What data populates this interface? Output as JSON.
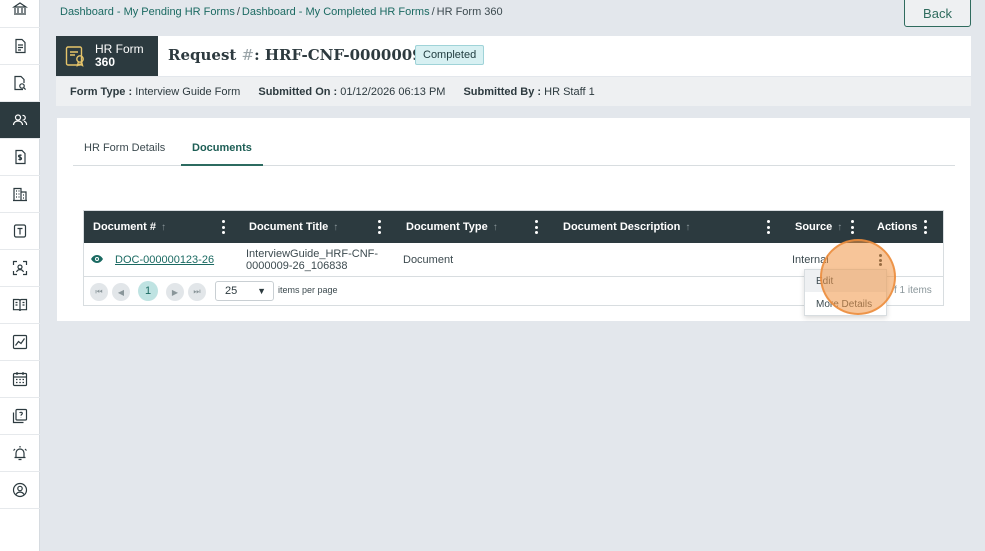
{
  "breadcrumb": {
    "items": [
      "Dashboard - My Pending HR Forms",
      "Dashboard - My Completed HR Forms"
    ],
    "separator": "/",
    "current": "HR Form 360"
  },
  "back_label": "Back",
  "header": {
    "logo_line1": "HR Form",
    "logo_line2": "360",
    "request_prefix": "Request ",
    "request_hash": "#",
    "request_suffix": ": HRF-CNF-0000009-26",
    "status": "Completed"
  },
  "meta": {
    "form_type_label": "Form Type :",
    "form_type_value": "Interview Guide Form",
    "submitted_on_label": "Submitted On :",
    "submitted_on_value": "01/12/2026 06:13 PM",
    "submitted_by_label": "Submitted By :",
    "submitted_by_value": "HR Staff 1"
  },
  "tabs": [
    "HR Form Details",
    "Documents"
  ],
  "active_tab": "Documents",
  "grid": {
    "columns": [
      "Document #",
      "Document Title",
      "Document Type",
      "Document Description",
      "Source",
      "Actions"
    ],
    "sort_arrow": "↑",
    "rows": [
      {
        "doc_number": "DOC-000000123-26",
        "title_line1": "InterviewGuide_HRF-CNF-",
        "title_line2": "0000009-26_106838",
        "type": "Document",
        "description": "",
        "source": "Internal"
      }
    ],
    "pager": {
      "first": "⏮",
      "prev": "◀",
      "page": "1",
      "next": "▶",
      "last": "⏭",
      "page_size": "25",
      "page_size_caret": "▼",
      "items_per_page": "items per page",
      "total": "f 1 items"
    }
  },
  "context_menu": {
    "items": [
      "Edit",
      "More Details"
    ]
  },
  "colors": {
    "accent": "#1b6a62",
    "dark": "#2c3a3f",
    "badge_bg": "#d7f0f2",
    "click_marker": "#f0964a"
  },
  "sidebar_icons": [
    "bank-icon",
    "document-icon",
    "document-search-icon",
    "users-icon",
    "dollar-document-icon",
    "building-icon",
    "template-icon",
    "scan-icon",
    "book-icon",
    "chart-icon",
    "calendar-icon",
    "help-icon",
    "alarm-icon",
    "profile-icon"
  ],
  "active_sidebar": "users-icon"
}
